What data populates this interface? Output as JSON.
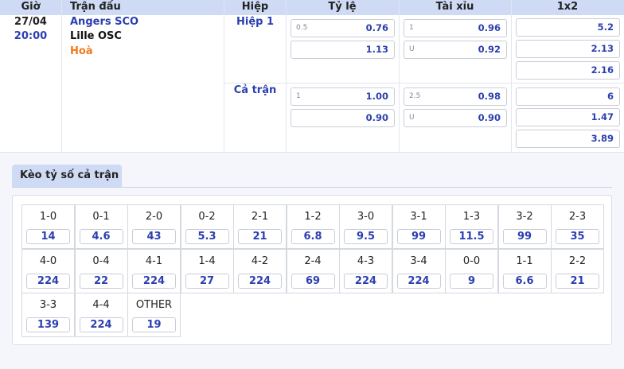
{
  "headers": {
    "time": "Giờ",
    "match": "Trận đấu",
    "period": "Hiệp",
    "handicap": "Tỷ lệ",
    "over_under": "Tài xỉu",
    "x12": "1x2"
  },
  "match": {
    "date": "27/04",
    "time": "20:00",
    "home": "Angers SCO",
    "away": "Lille OSC",
    "draw": "Hoà"
  },
  "colors": {
    "accent": "#2c3fb0",
    "header_bg": "#cfdaf5",
    "home": "#2c3fb0",
    "draw": "#f07a1a"
  },
  "periods": [
    {
      "label": "Hiệp 1",
      "handicap": [
        {
          "hint": "0.5",
          "value": "0.76"
        },
        {
          "hint": "",
          "value": "1.13"
        }
      ],
      "over_under": [
        {
          "hint": "1",
          "value": "0.96"
        },
        {
          "hint": "U",
          "value": "0.92"
        }
      ],
      "x12": [
        "5.2",
        "2.13",
        "2.16"
      ]
    },
    {
      "label": "Cả trận",
      "handicap": [
        {
          "hint": "1",
          "value": "1.00"
        },
        {
          "hint": "",
          "value": "0.90"
        }
      ],
      "over_under": [
        {
          "hint": "2.5",
          "value": "0.98"
        },
        {
          "hint": "U",
          "value": "0.90"
        }
      ],
      "x12": [
        "6",
        "1.47",
        "3.89"
      ]
    }
  ],
  "correct_score": {
    "tab_label": "Kèo tỷ số cả trận",
    "scores": [
      {
        "score": "1-0",
        "odds": "14"
      },
      {
        "score": "0-1",
        "odds": "4.6"
      },
      {
        "score": "2-0",
        "odds": "43"
      },
      {
        "score": "0-2",
        "odds": "5.3"
      },
      {
        "score": "2-1",
        "odds": "21"
      },
      {
        "score": "1-2",
        "odds": "6.8"
      },
      {
        "score": "3-0",
        "odds": "9.5"
      },
      {
        "score": "3-1",
        "odds": "99"
      },
      {
        "score": "1-3",
        "odds": "11.5"
      },
      {
        "score": "3-2",
        "odds": "99"
      },
      {
        "score": "2-3",
        "odds": "35"
      },
      {
        "score": "4-0",
        "odds": "224"
      },
      {
        "score": "0-4",
        "odds": "22"
      },
      {
        "score": "4-1",
        "odds": "224"
      },
      {
        "score": "1-4",
        "odds": "27"
      },
      {
        "score": "4-2",
        "odds": "224"
      },
      {
        "score": "2-4",
        "odds": "69"
      },
      {
        "score": "4-3",
        "odds": "224"
      },
      {
        "score": "3-4",
        "odds": "224"
      },
      {
        "score": "0-0",
        "odds": "9"
      },
      {
        "score": "1-1",
        "odds": "6.6"
      },
      {
        "score": "2-2",
        "odds": "21"
      },
      {
        "score": "3-3",
        "odds": "139"
      },
      {
        "score": "4-4",
        "odds": "224"
      },
      {
        "score": "OTHER",
        "odds": "19"
      }
    ]
  }
}
